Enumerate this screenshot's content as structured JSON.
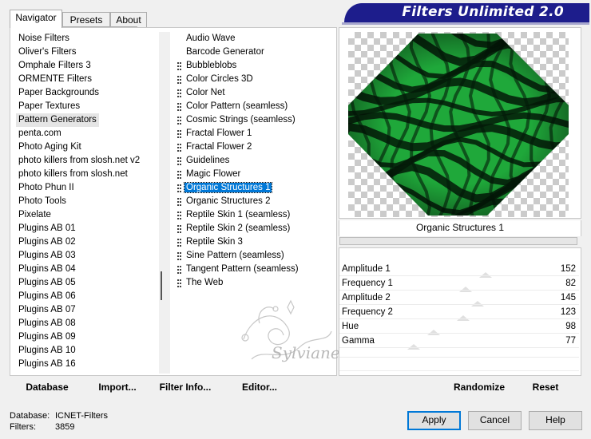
{
  "tabs": [
    {
      "label": "Navigator",
      "active": true
    },
    {
      "label": "Presets",
      "active": false
    },
    {
      "label": "About",
      "active": false
    }
  ],
  "title": "Filters Unlimited 2.0",
  "categories": {
    "items": [
      "Noise Filters",
      "Oliver's Filters",
      "Omphale Filters 3",
      "ORMENTE Filters",
      "Paper Backgrounds",
      "Paper Textures",
      "Pattern Generators",
      "penta.com",
      "Photo Aging Kit",
      "photo killers from slosh.net v2",
      "photo killers from slosh.net",
      "Photo Phun II",
      "Photo Tools",
      "Pixelate",
      "Plugins AB 01",
      "Plugins AB 02",
      "Plugins AB 03",
      "Plugins AB 04",
      "Plugins AB 05",
      "Plugins AB 06",
      "Plugins AB 07",
      "Plugins AB 08",
      "Plugins AB 09",
      "Plugins AB 10",
      "Plugins AB 16"
    ],
    "selected": "Pattern Generators"
  },
  "filters": {
    "items": [
      "Audio Wave",
      "Barcode Generator",
      "Bubbleblobs",
      "Color Circles 3D",
      "Color Net",
      "Color Pattern (seamless)",
      "Cosmic Strings (seamless)",
      "Fractal Flower 1",
      "Fractal Flower 2",
      "Guidelines",
      "Magic Flower",
      "Organic Structures 1",
      "Organic Structures 2",
      "Reptile Skin 1 (seamless)",
      "Reptile Skin 2 (seamless)",
      "Reptile Skin 3",
      "Sine Pattern (seamless)",
      "Tangent Pattern (seamless)",
      "The Web"
    ],
    "marked_from": 2,
    "selected": "Organic Structures 1"
  },
  "left_buttons": {
    "database": "Database",
    "import": "Import...",
    "filter_info": "Filter Info...",
    "editor": "Editor..."
  },
  "preview": {
    "filter_name": "Organic Structures 1",
    "colors": {
      "green": "#1fa83a",
      "dark": "#031a08"
    }
  },
  "params": [
    {
      "label": "Amplitude 1",
      "value": "152"
    },
    {
      "label": "Frequency 1",
      "value": "82"
    },
    {
      "label": "Amplitude 2",
      "value": "145"
    },
    {
      "label": "Frequency 2",
      "value": "123"
    },
    {
      "label": "Hue",
      "value": "98"
    },
    {
      "label": "Gamma",
      "value": "77"
    }
  ],
  "right_buttons": {
    "randomize": "Randomize",
    "reset": "Reset"
  },
  "status": {
    "database_label": "Database:",
    "database_value": "ICNET-Filters",
    "filters_label": "Filters:",
    "filters_value": "3859"
  },
  "dialog_buttons": {
    "apply": "Apply",
    "cancel": "Cancel",
    "help": "Help"
  },
  "watermark_text": "Sylviane"
}
